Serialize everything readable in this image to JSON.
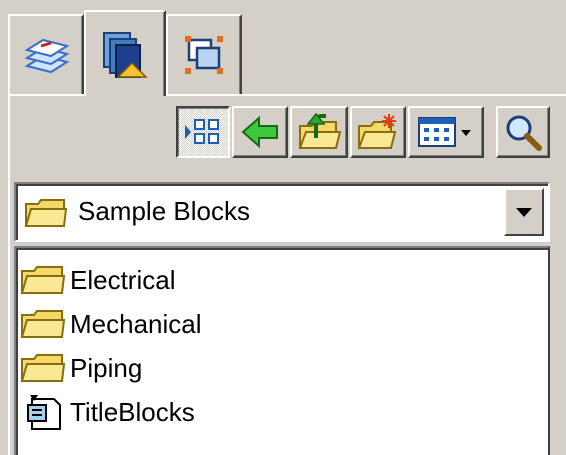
{
  "tabs": [
    {
      "name": "layers",
      "icon": "layers-stack-icon"
    },
    {
      "name": "blocks",
      "icon": "block-library-icon"
    },
    {
      "name": "selection",
      "icon": "selection-frame-icon"
    }
  ],
  "toolbar": [
    {
      "icon": "tree-view-toggle-icon"
    },
    {
      "icon": "back-arrow-icon"
    },
    {
      "icon": "up-folder-icon"
    },
    {
      "icon": "new-folder-icon"
    },
    {
      "icon": "view-options-icon"
    },
    {
      "icon": "search-icon"
    }
  ],
  "location": {
    "selected": "Sample Blocks",
    "icon": "folder-icon"
  },
  "items": [
    {
      "label": "Electrical",
      "icon": "folder-icon"
    },
    {
      "label": "Mechanical",
      "icon": "folder-icon"
    },
    {
      "label": "Piping",
      "icon": "folder-icon"
    },
    {
      "label": "TitleBlocks",
      "icon": "block-file-icon"
    }
  ],
  "colors": {
    "face": "#d4d0c8",
    "folder": "#f5d86a",
    "folder_edge": "#8a6d10",
    "arrow_green": "#2ea82e"
  }
}
